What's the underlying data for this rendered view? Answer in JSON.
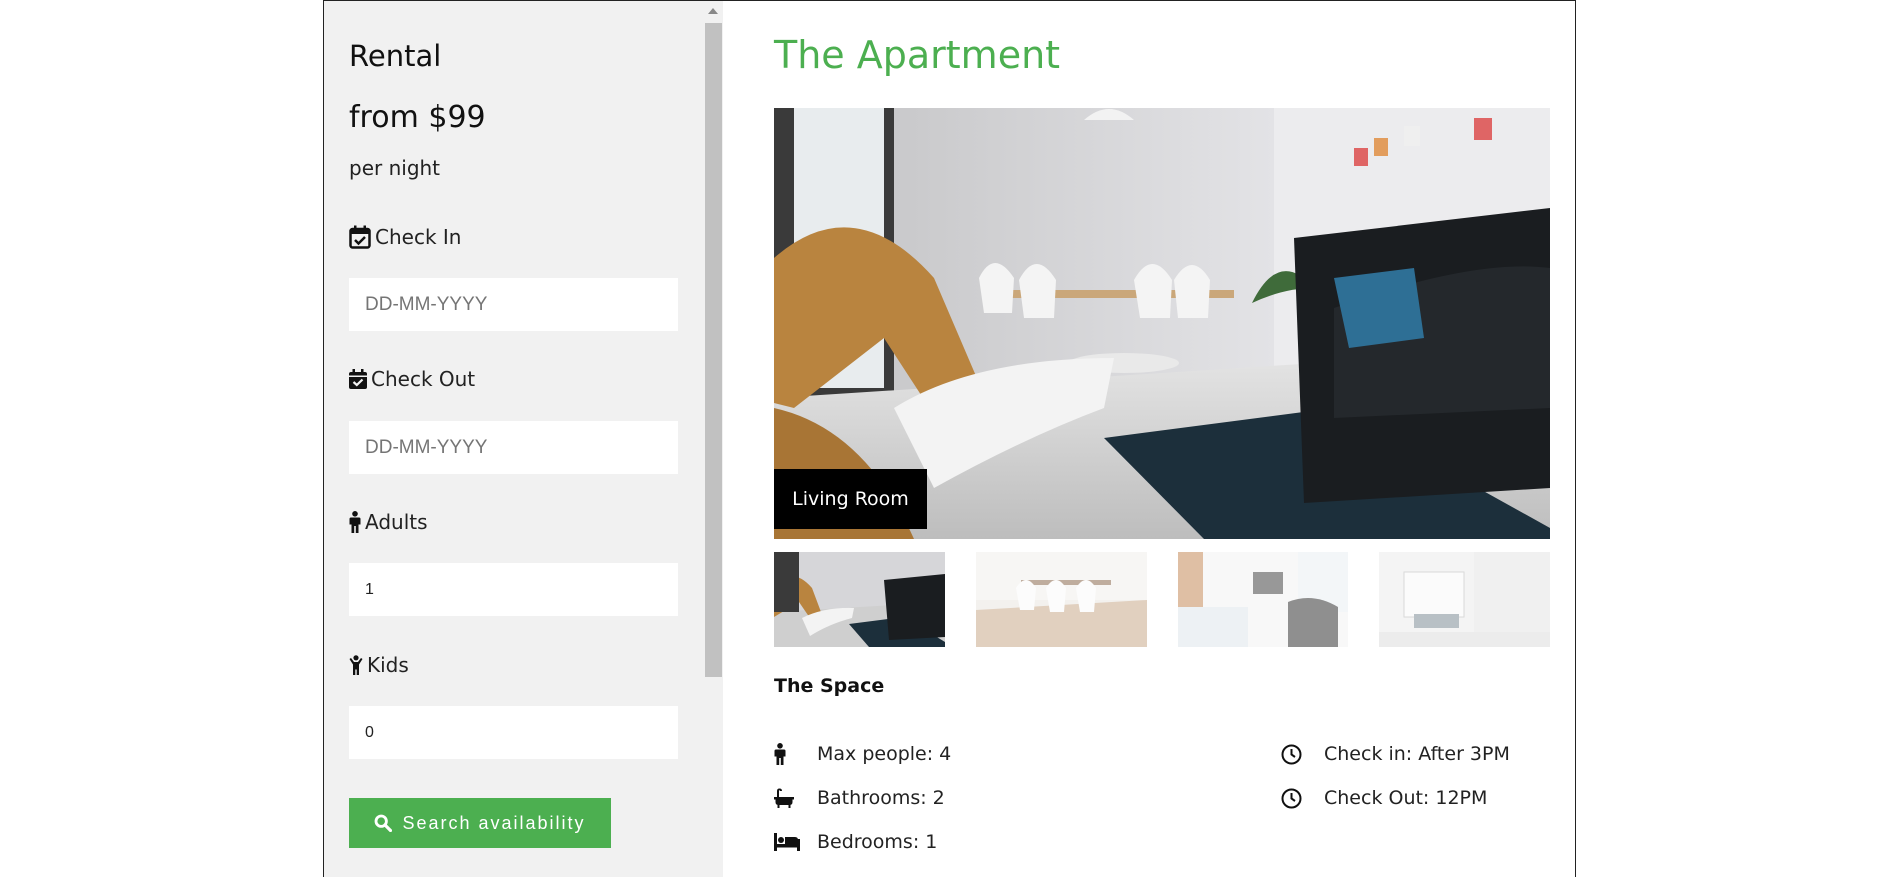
{
  "sidebar": {
    "title": "Rental",
    "price": "from $99",
    "per_night": "per night",
    "check_in_label": "Check In",
    "check_in_placeholder": "DD-MM-YYYY",
    "check_out_label": "Check Out",
    "check_out_placeholder": "DD-MM-YYYY",
    "adults_label": "Adults",
    "adults_value": "1",
    "kids_label": "Kids",
    "kids_value": "0",
    "search_label": "Search availability"
  },
  "main": {
    "title": "The Apartment",
    "hero_caption": "Living Room",
    "space_title": "The Space",
    "amenities_left": [
      "Max people: 4",
      "Bathrooms: 2",
      "Bedrooms: 1"
    ],
    "amenities_right": [
      "Check in: After 3PM",
      "Check Out: 12PM"
    ]
  },
  "colors": {
    "accent": "#4caf50",
    "sidebar_bg": "#f1f1f1",
    "caption_bg": "#000000"
  },
  "icons": [
    "calendar-check-icon",
    "calendar-check-solid-icon",
    "male-icon",
    "child-icon",
    "search-icon",
    "bath-icon",
    "bed-icon",
    "clock-icon"
  ]
}
